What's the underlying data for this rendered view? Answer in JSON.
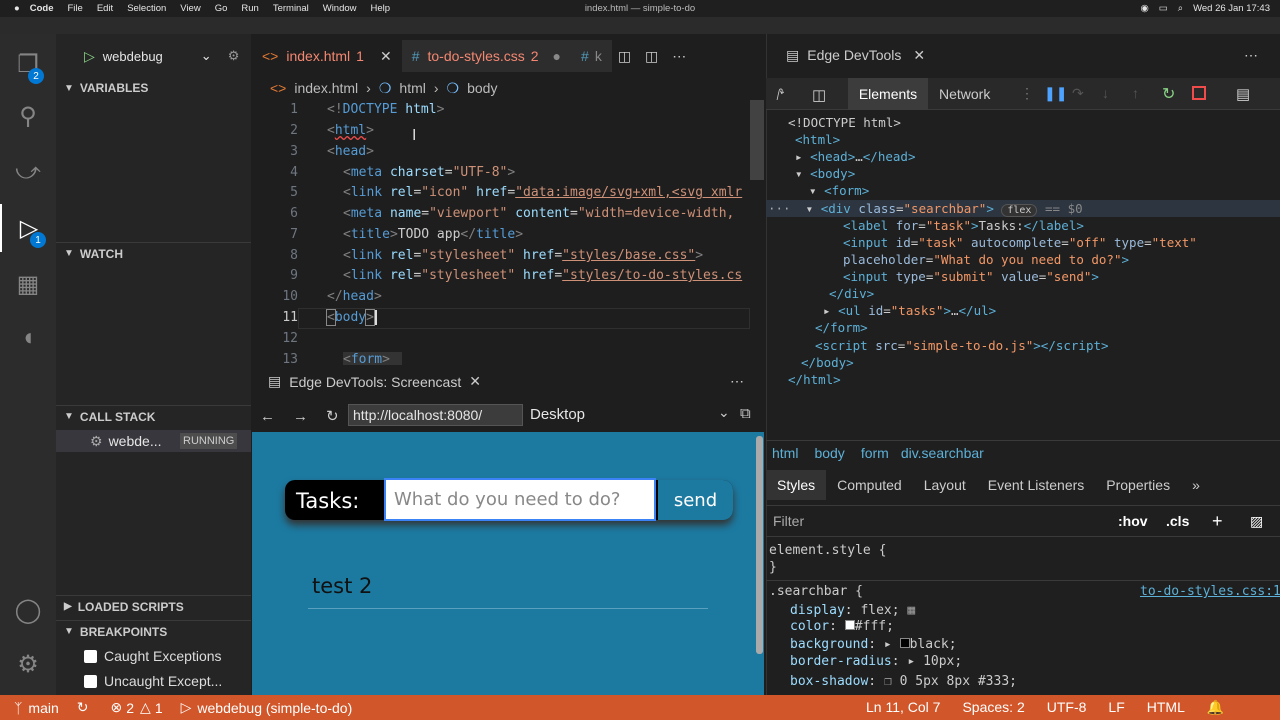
{
  "menubar": {
    "apple": "",
    "app": "Code",
    "items": [
      "File",
      "Edit",
      "Selection",
      "View",
      "Go",
      "Run",
      "Terminal",
      "Window",
      "Help"
    ],
    "title": "index.html — simple-to-do",
    "clock": "Wed 26 Jan  17:43"
  },
  "activity": {
    "explorer_badge": "2",
    "debug_badge": "1"
  },
  "sidebar": {
    "config": "webdebug",
    "variables": "VARIABLES",
    "watch": "WATCH",
    "callstack": "CALL STACK",
    "callstack_item": "webde...",
    "callstack_status": "RUNNING",
    "loaded_scripts": "LOADED SCRIPTS",
    "breakpoints": "BREAKPOINTS",
    "bp1": "Caught Exceptions",
    "bp2": "Uncaught Except..."
  },
  "editor": {
    "tab1": "index.html",
    "tab1_count": "1",
    "tab2": "to-do-styles.css",
    "tab2_count": "2",
    "tab3": "k",
    "crumbs": [
      "index.html",
      "html",
      "body"
    ]
  },
  "code": {
    "l1": [
      "<!",
      "DOCTYPE",
      " html",
      ">"
    ],
    "l2": [
      "<",
      "html",
      ">"
    ],
    "l3": [
      "<",
      "head",
      ">"
    ],
    "l4": {
      "tag": "meta",
      "attr": "charset",
      "val": "\"UTF-8\""
    },
    "l5": {
      "tag": "link",
      "a1": "rel",
      "v1": "\"icon\"",
      "a2": "href",
      "v2": "\"data:image/svg+xml,<svg xmlr"
    },
    "l6": {
      "tag": "meta",
      "a1": "name",
      "v1": "\"viewport\"",
      "a2": "content",
      "v2": "\"width=device-width,"
    },
    "l7": {
      "tag": "title",
      "text": "TODO app"
    },
    "l8": {
      "tag": "link",
      "a1": "rel",
      "v1": "\"stylesheet\"",
      "a2": "href",
      "v2": "\"styles/base.css\""
    },
    "l9": {
      "tag": "link",
      "a1": "rel",
      "v1": "\"stylesheet\"",
      "a2": "href",
      "v2": "\"styles/to-do-styles.cs"
    },
    "l10": "head",
    "l11": "body",
    "l13": "form"
  },
  "screencast": {
    "tab": "Edge DevTools: Screencast",
    "url": "http://localhost:8080/",
    "device": "Desktop",
    "label": "Tasks:",
    "placeholder": "What do you need to do?",
    "send": "send",
    "item": "test 2"
  },
  "devtools": {
    "title": "Edge DevTools",
    "tabs": [
      "Elements",
      "Network"
    ],
    "dom": {
      "d0": "<!DOCTYPE html>",
      "d1": "html",
      "d2": "head",
      "d3": "body",
      "d4": "form",
      "d5_tag": "div",
      "d5_attr": "class",
      "d5_val": "\"searchbar\"",
      "d5_badge": "flex",
      "d5_eq": "== $0",
      "d6_tag": "label",
      "d6_attr": "for",
      "d6_val": "\"task\"",
      "d6_text": "Tasks:",
      "d7_tag": "input",
      "d7_a1": "id",
      "d7_v1": "\"task\"",
      "d7_a2": "autocomplete",
      "d7_v2": "\"off\"",
      "d7_a3": "type",
      "d7_v3": "\"text\"",
      "d8_a": "placeholder",
      "d8_v": "\"What do you need to do?\"",
      "d9_tag": "input",
      "d9_a1": "type",
      "d9_v1": "\"submit\"",
      "d9_a2": "value",
      "d9_v2": "\"send\"",
      "d10": "div",
      "d11_tag": "ul",
      "d11_attr": "id",
      "d11_val": "\"tasks\"",
      "d12": "form",
      "d13_tag": "script",
      "d13_attr": "src",
      "d13_val": "\"simple-to-do.js\"",
      "d14": "body",
      "d15": "html"
    },
    "crumbs": [
      "html",
      "body",
      "form",
      "div.searchbar"
    ],
    "style_tabs": [
      "Styles",
      "Computed",
      "Layout",
      "Event Listeners",
      "Properties"
    ],
    "filter": "Filter",
    "hov": ":hov",
    "cls": ".cls",
    "element_style": "element.style {",
    "close_brace": "}",
    "rule_selector": ".searchbar {",
    "rule_source": "to-do-styles.css:1",
    "props": [
      [
        "display",
        "flex;"
      ],
      [
        "color",
        "#fff;"
      ],
      [
        "background",
        "black;"
      ],
      [
        "border-radius",
        "10px;"
      ],
      [
        "box-shadow",
        "0 5px 8px #333;"
      ]
    ]
  },
  "status": {
    "branch": "main",
    "errors": "2",
    "warnings": "1",
    "debug": "webdebug (simple-to-do)",
    "position": "Ln 11, Col 7",
    "spaces": "Spaces: 2",
    "encoding": "UTF-8",
    "eol": "LF",
    "lang": "HTML"
  }
}
